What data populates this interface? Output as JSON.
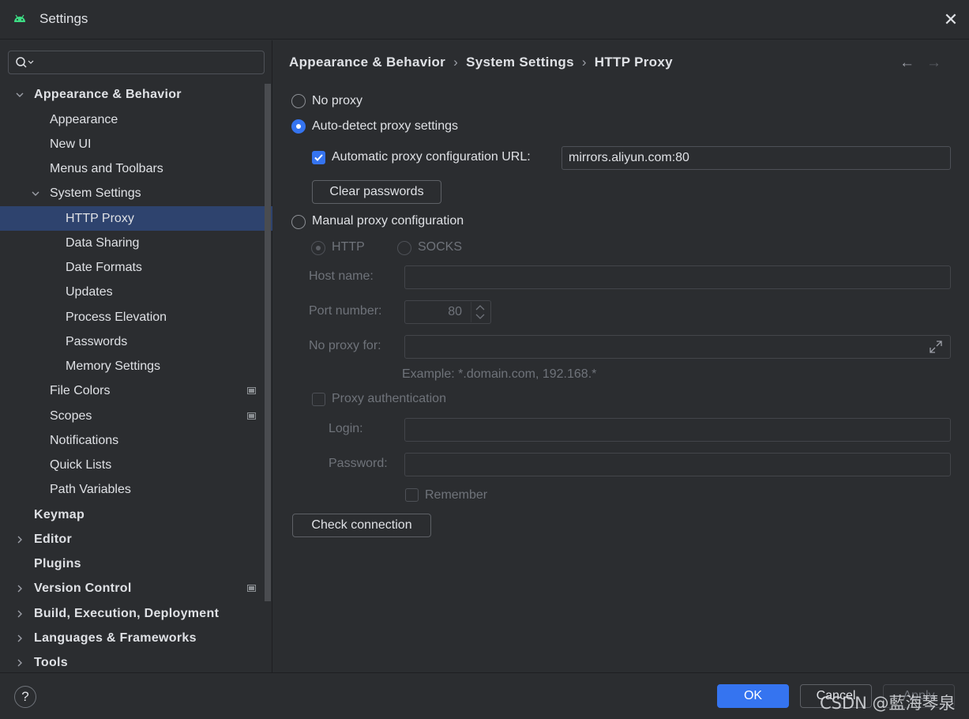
{
  "window": {
    "title": "Settings",
    "close_glyph": "✕"
  },
  "sidebar": {
    "search": {
      "placeholder": ""
    },
    "items": [
      {
        "label": "Appearance & Behavior",
        "expanded": true
      },
      {
        "label": "Appearance"
      },
      {
        "label": "New UI"
      },
      {
        "label": "Menus and Toolbars"
      },
      {
        "label": "System Settings",
        "expanded": true
      },
      {
        "label": "HTTP Proxy",
        "selected": true
      },
      {
        "label": "Data Sharing"
      },
      {
        "label": "Date Formats"
      },
      {
        "label": "Updates"
      },
      {
        "label": "Process Elevation"
      },
      {
        "label": "Passwords"
      },
      {
        "label": "Memory Settings"
      },
      {
        "label": "File Colors"
      },
      {
        "label": "Scopes"
      },
      {
        "label": "Notifications"
      },
      {
        "label": "Quick Lists"
      },
      {
        "label": "Path Variables"
      },
      {
        "label": "Keymap"
      },
      {
        "label": "Editor"
      },
      {
        "label": "Plugins"
      },
      {
        "label": "Version Control"
      },
      {
        "label": "Build, Execution, Deployment"
      },
      {
        "label": "Languages & Frameworks"
      },
      {
        "label": "Tools"
      }
    ]
  },
  "breadcrumb": {
    "part1": "Appearance & Behavior",
    "part2": "System Settings",
    "part3": "HTTP Proxy",
    "sep": "›"
  },
  "nav": {
    "back": "←",
    "forward": "→"
  },
  "proxy": {
    "no_proxy": "No proxy",
    "auto_detect": "Auto-detect proxy settings",
    "auto_url_label": "Automatic proxy configuration URL:",
    "auto_url_value": "mirrors.aliyun.com:80",
    "clear_passwords": "Clear passwords",
    "manual": "Manual proxy configuration",
    "http": "HTTP",
    "socks": "SOCKS",
    "host_label": "Host name:",
    "host_value": "",
    "port_label": "Port number:",
    "port_value": "80",
    "no_proxy_for_label": "No proxy for:",
    "no_proxy_for_value": "",
    "example": "Example: *.domain.com, 192.168.*",
    "proxy_auth": "Proxy authentication",
    "login_label": "Login:",
    "login_value": "",
    "password_label": "Password:",
    "password_value": "",
    "remember": "Remember",
    "check_connection": "Check connection"
  },
  "footer": {
    "help": "?",
    "ok": "OK",
    "cancel": "Cancel",
    "apply": "Apply"
  },
  "watermark": "CSDN @藍海琴泉",
  "colors": {
    "accent": "#3574f0",
    "selection": "#2e436e",
    "background": "#2b2d30"
  }
}
